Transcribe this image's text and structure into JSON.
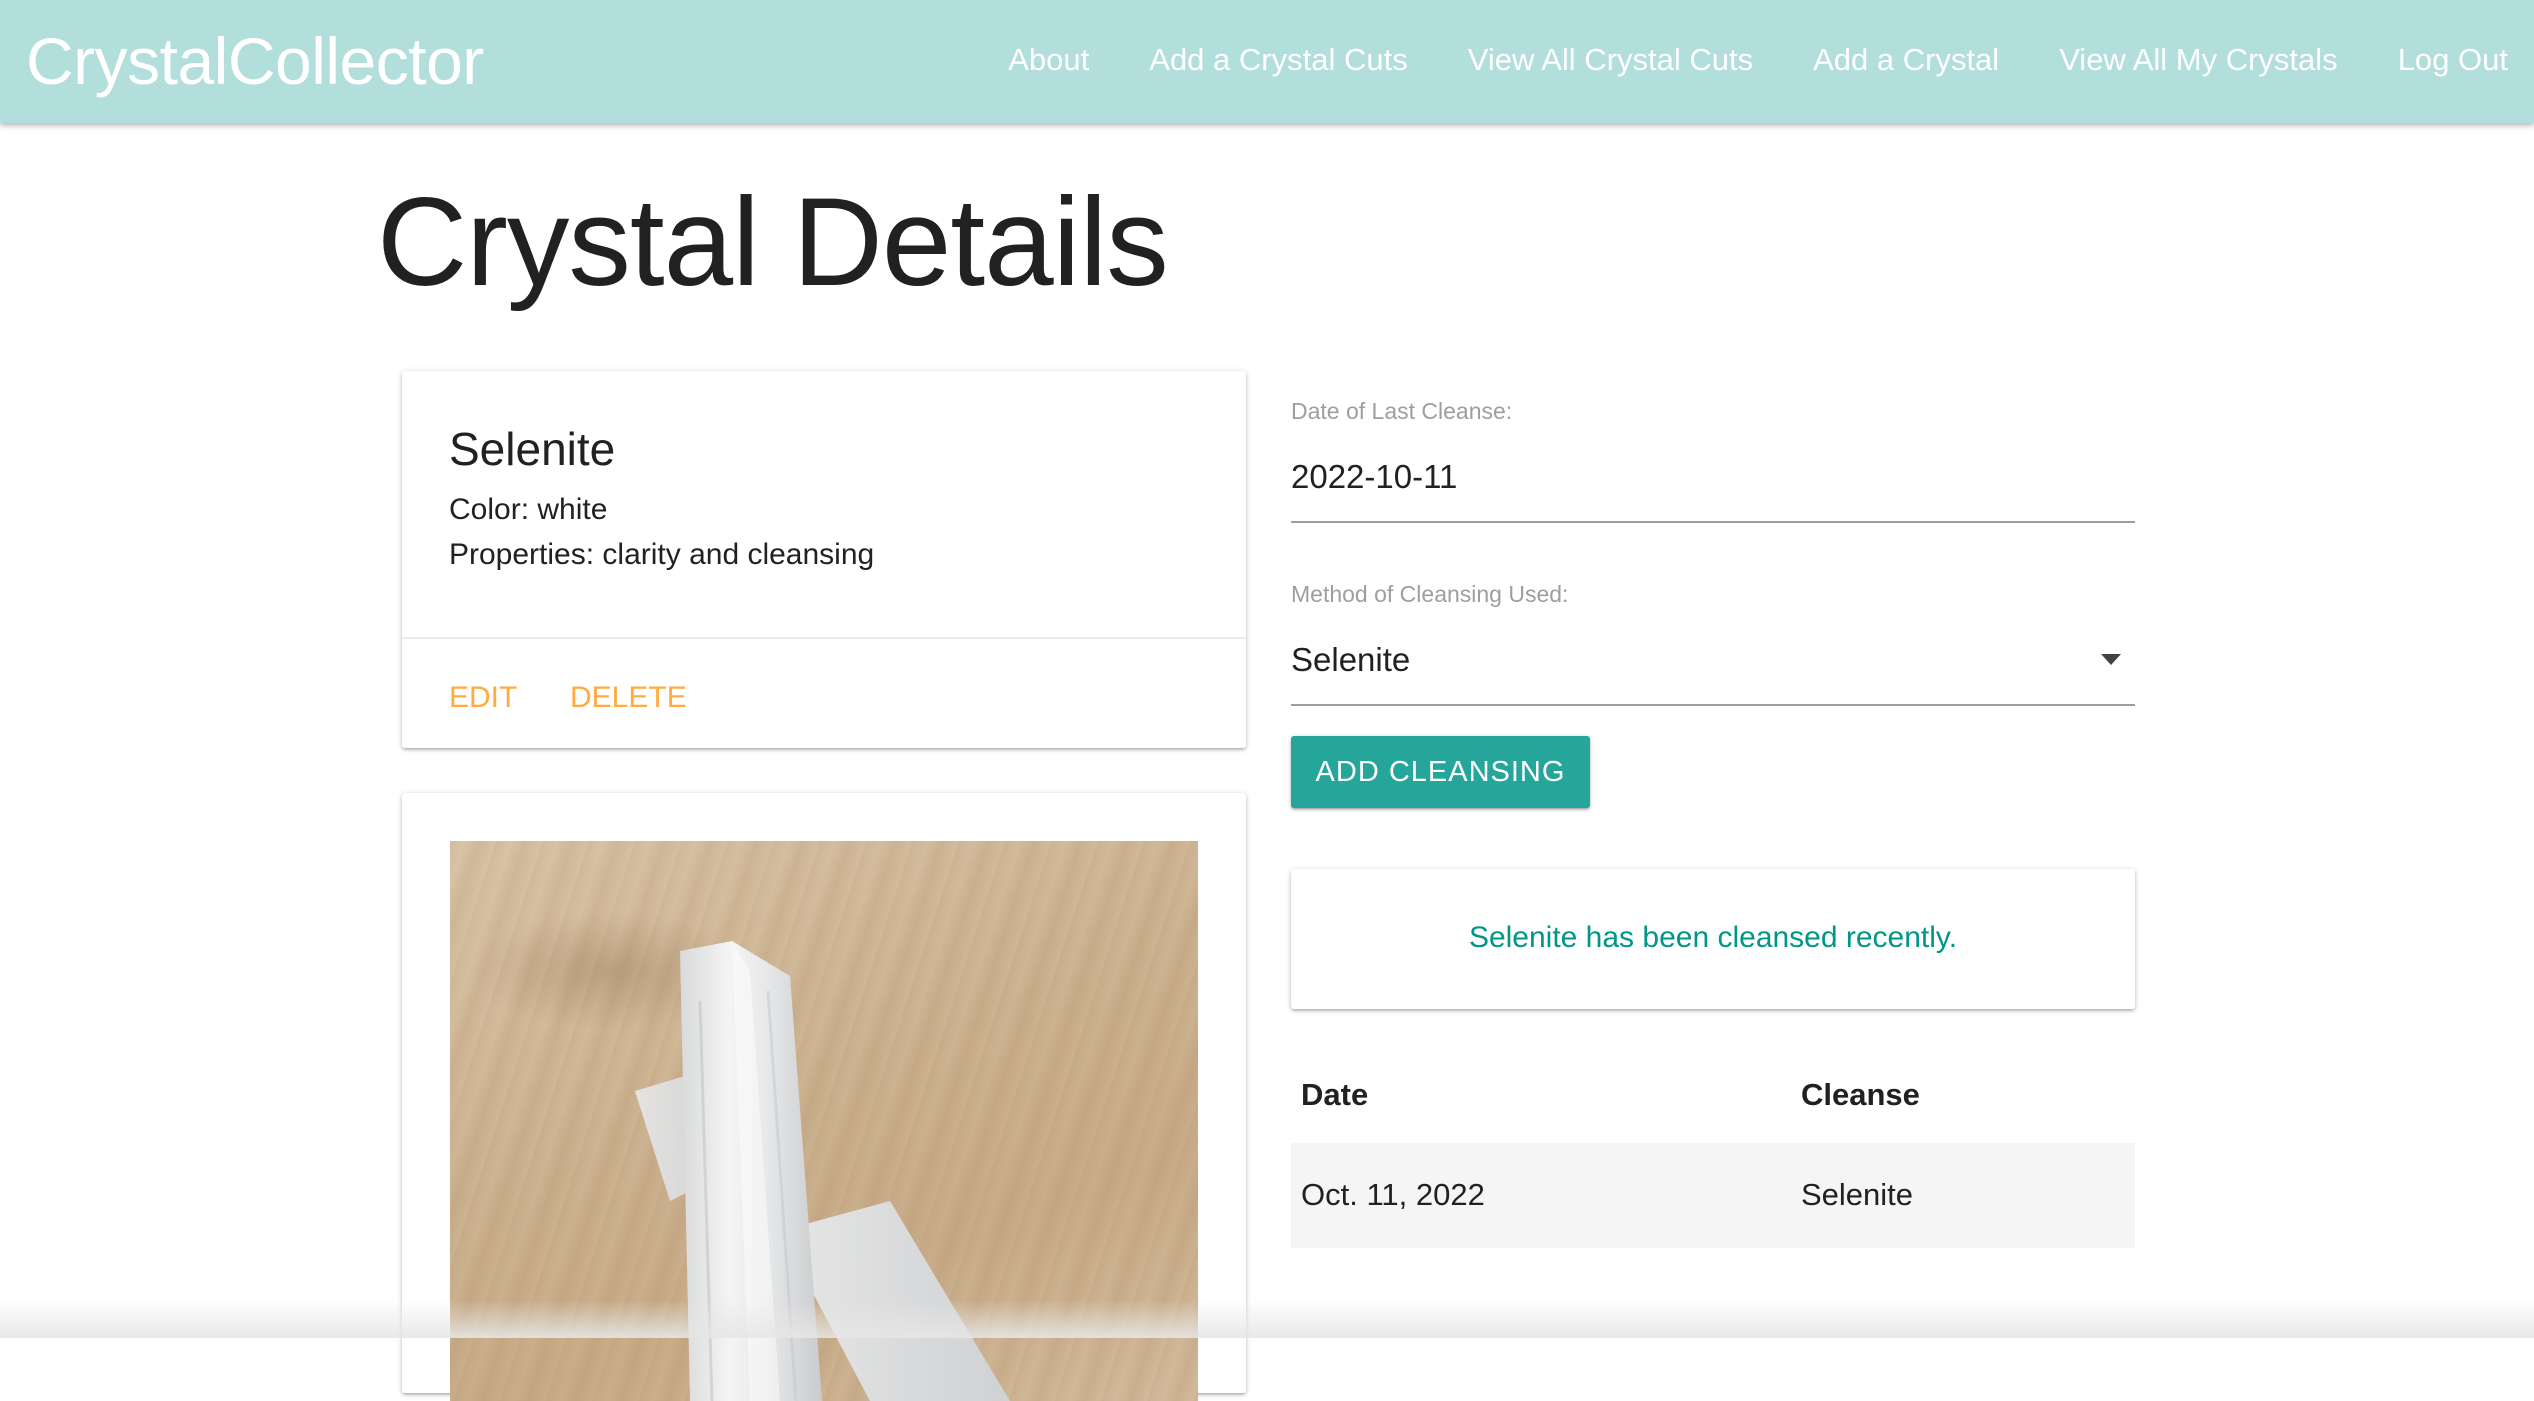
{
  "nav": {
    "brand": "CrystalCollector",
    "links": [
      "About",
      "Add a Crystal Cuts",
      "View All Crystal Cuts",
      "Add a Crystal",
      "View All My Crystals",
      "Log Out"
    ],
    "background_color": "#b2dfdb"
  },
  "page": {
    "title": "Crystal Details"
  },
  "crystal": {
    "name": "Selenite",
    "color_line": "Color: white",
    "properties_line": "Properties: clarity and cleansing",
    "actions": {
      "edit": "EDIT",
      "delete": "DELETE"
    },
    "action_color": "#ffab40"
  },
  "cleanse_form": {
    "date_label": "Date of Last Cleanse:",
    "date_value": "2022-10-11",
    "method_label": "Method of Cleansing Used:",
    "method_value": "Selenite",
    "submit_label": "ADD CLEANSING",
    "button_color": "#26a69a"
  },
  "status": {
    "message": "Selenite has been cleansed recently.",
    "color": "#009688"
  },
  "history": {
    "headers": {
      "date": "Date",
      "cleanse": "Cleanse"
    },
    "rows": [
      {
        "date": "Oct. 11, 2022",
        "cleanse": "Selenite"
      }
    ]
  }
}
